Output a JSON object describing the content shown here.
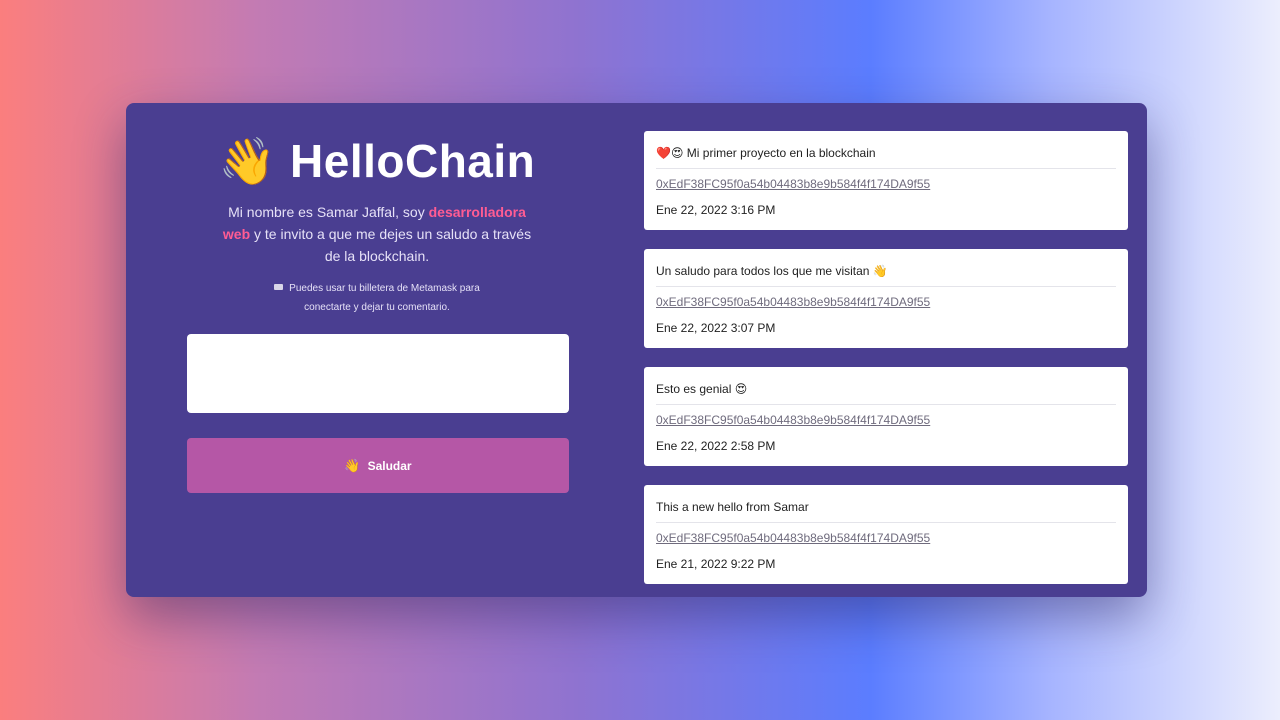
{
  "header": {
    "wave_emoji": "👋",
    "title": "HelloChain"
  },
  "intro": {
    "text_before": "Mi nombre es Samar Jaffal, soy ",
    "highlight": "desarrolladora web",
    "text_after": " y te invito a que me dejes un saludo a través de la blockchain.",
    "highlight_color": "#ff5c93"
  },
  "hint": {
    "icon": "wallet-icon",
    "text": "Puedes usar tu billetera de Metamask para conectarte y dejar tu comentario."
  },
  "form": {
    "comment_value": "",
    "button_emoji": "👋",
    "button_label": "Saludar",
    "button_color": "#b557a6"
  },
  "messages": [
    {
      "text": "❤️😍 Mi primer proyecto en la blockchain",
      "address": "0xEdF38FC95f0a54b04483b8e9b584f4f174DA9f55",
      "date": "Ene 22, 2022 3:16 PM"
    },
    {
      "text": "Un saludo para todos los que me visitan 👋",
      "address": "0xEdF38FC95f0a54b04483b8e9b584f4f174DA9f55",
      "date": "Ene 22, 2022 3:07 PM"
    },
    {
      "text": "Esto es genial 😍",
      "address": "0xEdF38FC95f0a54b04483b8e9b584f4f174DA9f55",
      "date": "Ene 22, 2022 2:58 PM"
    },
    {
      "text": "This a new hello from Samar",
      "address": "0xEdF38FC95f0a54b04483b8e9b584f4f174DA9f55",
      "date": "Ene 21, 2022 9:22 PM"
    }
  ],
  "colors": {
    "card_background": "#4a3e91",
    "message_background": "#ffffff"
  }
}
